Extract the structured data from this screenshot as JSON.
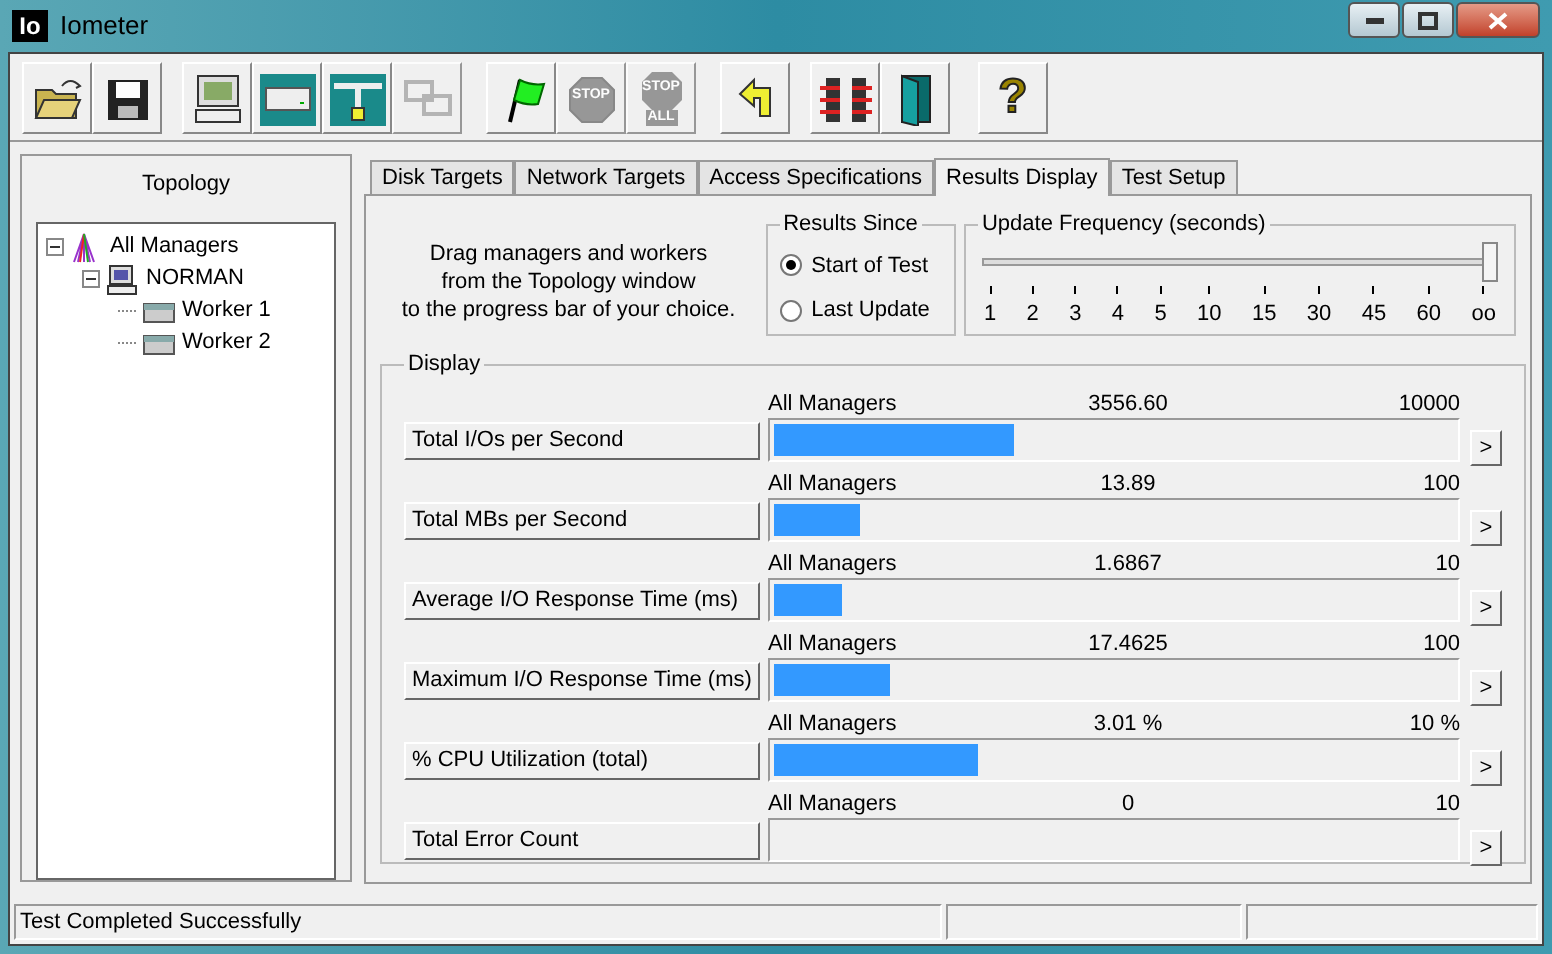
{
  "window": {
    "title": "Iometer",
    "logo": "Io"
  },
  "toolbar": [
    {
      "kind": "open",
      "disabled": false
    },
    {
      "kind": "save",
      "disabled": false
    },
    {
      "kind": "manager",
      "disabled": false
    },
    {
      "kind": "worker",
      "disabled": false
    },
    {
      "kind": "network",
      "disabled": false
    },
    {
      "kind": "copy",
      "disabled": true
    },
    {
      "kind": "flag",
      "disabled": false
    },
    {
      "kind": "stop",
      "disabled": true,
      "labels": [
        "STOP"
      ]
    },
    {
      "kind": "stopall",
      "disabled": true,
      "labels": [
        "STOP",
        "ALL"
      ]
    },
    {
      "kind": "reset",
      "disabled": false
    },
    {
      "kind": "exit-all",
      "disabled": false
    },
    {
      "kind": "door",
      "disabled": false
    },
    {
      "kind": "help",
      "disabled": false,
      "labels": [
        "?"
      ]
    }
  ],
  "topology": {
    "title": "Topology",
    "tree": [
      {
        "label": "All Managers",
        "kind": "all",
        "expanded": true,
        "children": [
          {
            "label": "NORMAN",
            "kind": "manager",
            "expanded": true,
            "children": [
              {
                "label": "Worker 1",
                "kind": "worker"
              },
              {
                "label": "Worker 2",
                "kind": "worker"
              }
            ]
          }
        ]
      }
    ]
  },
  "tabs": [
    {
      "label": "Disk Targets",
      "selected": false
    },
    {
      "label": "Network Targets",
      "selected": false
    },
    {
      "label": "Access Specifications",
      "selected": false
    },
    {
      "label": "Results Display",
      "selected": true
    },
    {
      "label": "Test Setup",
      "selected": false
    }
  ],
  "instructions": "Drag managers and workers\nfrom the Topology window\nto the progress bar of your choice.",
  "results_since": {
    "title": "Results Since",
    "options": [
      {
        "label": "Start of Test",
        "selected": true
      },
      {
        "label": "Last Update",
        "selected": false
      }
    ]
  },
  "update_frequency": {
    "title": "Update Frequency (seconds)",
    "level": 1,
    "ticks": [
      "1",
      "2",
      "3",
      "4",
      "5",
      "10",
      "15",
      "30",
      "45",
      "60",
      "oo"
    ]
  },
  "display": {
    "title": "Display",
    "rows": [
      {
        "button": "Total I/Os per Second",
        "source": "All Managers",
        "value": "3556.60",
        "max": "10000",
        "level": 0.352
      },
      {
        "button": "Total MBs per Second",
        "source": "All Managers",
        "value": "13.89",
        "max": "100",
        "level": 0.127
      },
      {
        "button": "Average I/O Response Time (ms)",
        "source": "All Managers",
        "value": "1.6867",
        "max": "10",
        "level": 0.1
      },
      {
        "button": "Maximum I/O Response Time (ms)",
        "source": "All Managers",
        "value": "17.4625",
        "max": "100",
        "level": 0.17
      },
      {
        "button": "% CPU Utilization (total)",
        "source": "All Managers",
        "value": "3.01 %",
        "max": "10 %",
        "level": 0.3
      },
      {
        "button": "Total Error Count",
        "source": "All Managers",
        "value": "0",
        "max": "10",
        "level": 0
      }
    ],
    "more_button": ">"
  },
  "status_bar": [
    "Test Completed Successfully"
  ]
}
